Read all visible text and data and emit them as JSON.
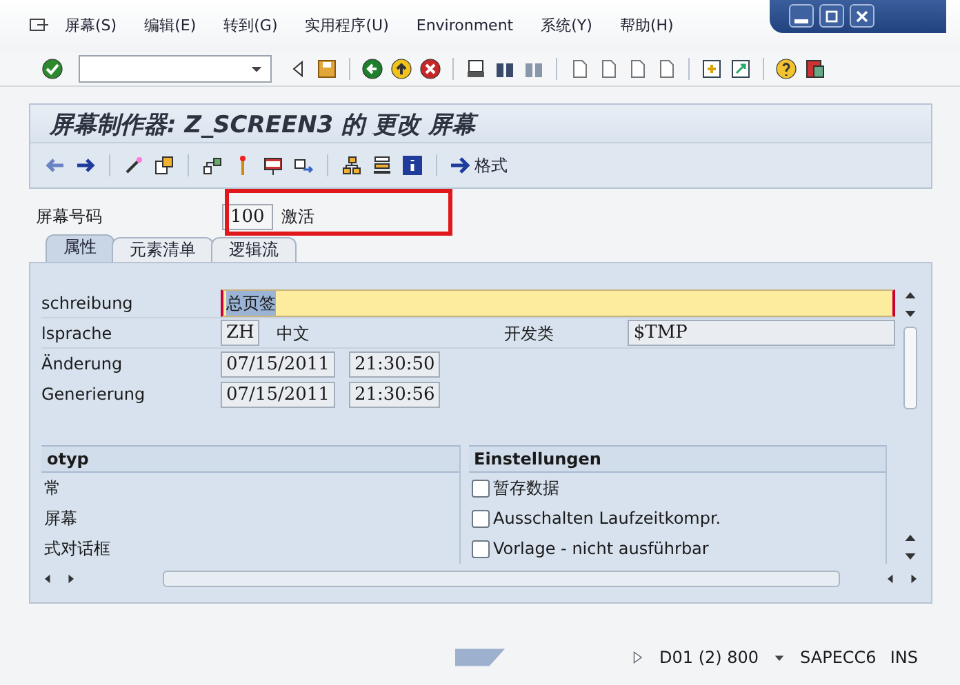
{
  "menu": [
    {
      "label": "屏幕(S)"
    },
    {
      "label": "编辑(E)"
    },
    {
      "label": "转到(G)"
    },
    {
      "label": "实用程序(U)"
    },
    {
      "label": "Environment"
    },
    {
      "label": "系统(Y)"
    },
    {
      "label": "帮助(H)"
    }
  ],
  "title": "屏幕制作器: Z_SCREEN3 的 更改 屏幕",
  "app_toolbar": {
    "format_button": "格式"
  },
  "screen_number": {
    "label": "屏幕号码",
    "value": "100",
    "status": "激活"
  },
  "tabs": [
    {
      "label": "属性",
      "selected": true
    },
    {
      "label": "元素清单",
      "selected": false
    },
    {
      "label": "逻辑流",
      "selected": false
    }
  ],
  "attributes": {
    "description": {
      "label": "schreibung",
      "value": "总页签",
      "focused": true
    },
    "language": {
      "label": "lsprache",
      "code": "ZH",
      "name": "中文"
    },
    "package": {
      "label": "开发类",
      "value": "$TMP"
    },
    "changed": {
      "label": "Änderung",
      "date": "07/15/2011",
      "time": "21:30:50"
    },
    "generated": {
      "label": "Generierung",
      "date": "07/15/2011",
      "time": "21:30:56"
    }
  },
  "screen_type": {
    "header": "otyp",
    "options": [
      {
        "label": "常"
      },
      {
        "label": "屏幕"
      },
      {
        "label": "式对话框"
      }
    ]
  },
  "settings": {
    "header": "Einstellungen",
    "options": [
      {
        "label": "暂存数据",
        "checked": false
      },
      {
        "label": "Ausschalten Laufzeitkompr.",
        "checked": false
      },
      {
        "label": "Vorlage - nicht ausführbar",
        "checked": false
      }
    ]
  },
  "status_bar": {
    "system": "D01 (2) 800",
    "server": "SAPECC6",
    "mode": "INS"
  }
}
